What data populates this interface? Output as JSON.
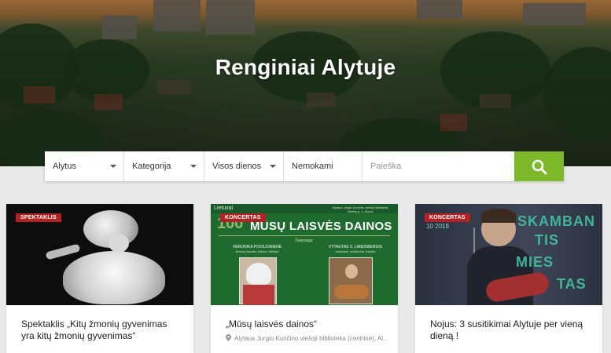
{
  "hero": {
    "title": "Renginiai Alytuje"
  },
  "search": {
    "city": "Alytus",
    "category": "Kategorija",
    "dates": "Visos dienos",
    "price": "Nemokami",
    "placeholder": "Paieška"
  },
  "colors": {
    "accent": "#7cb82a",
    "badge": "#b22222"
  },
  "cards": [
    {
      "badge": "SPEKTAKLIS",
      "title": "Spektaklis „Kitų žmonių gyvenimas yra kitų žmonių gyvenimas“"
    },
    {
      "badge": "KONCERTAS",
      "title": "„Mūsų laisvės dainos“",
      "venue": "Alytaus Jurgio Kunčino viešoji biblioteka (centrinė), Al...",
      "poster": {
        "top_left": "Lietuvai",
        "number": "100",
        "heading": "MŪSŲ LAISVĖS DAINOS",
        "top_right": "Alytaus Jurgio Kunčino viešoji biblioteka Vertėjų g. 4, Alytus",
        "dalyvauja": "Dalyvauja:",
        "name_left": "VERONIKA POVILIONIENĖ",
        "desc_left": "lietuvių liaudies folkloro atlikėja",
        "name_right": "VYTAUTAS V. LANDSBERGIS",
        "desc_right": "rašytojas, režisierius, bardas"
      }
    },
    {
      "badge": "KONCERTAS",
      "title": "Nojus: 3 susitikimai Alytuje per vieną dieną !",
      "poster": {
        "date": "10 2018",
        "words": [
          "SKAMBAN",
          "TIS",
          "MIES",
          "TAS"
        ]
      }
    }
  ],
  "icons": {
    "search": "search-icon",
    "caret": "chevron-down-icon",
    "pin": "map-pin-icon"
  }
}
